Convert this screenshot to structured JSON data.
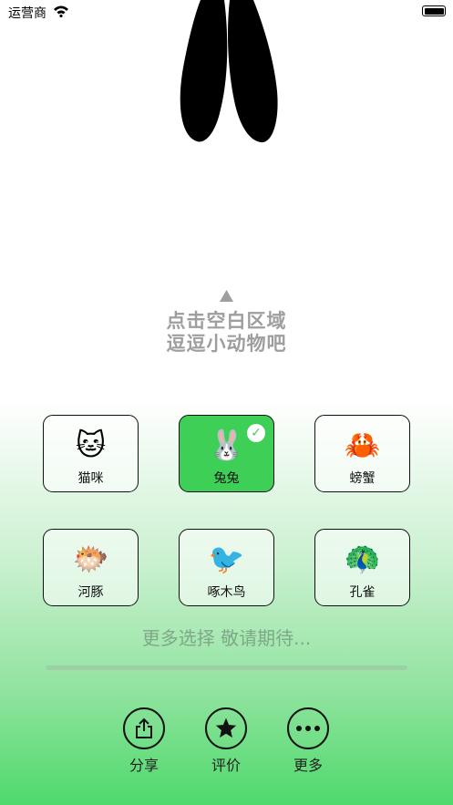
{
  "status_bar": {
    "carrier": "运营商"
  },
  "hint": {
    "line1": "点击空白区域",
    "line2": "逗逗小动物吧"
  },
  "animals": [
    {
      "emoji": "🐱",
      "label": "猫咪",
      "selected": false
    },
    {
      "emoji": "🐰",
      "label": "兔兔",
      "selected": true
    },
    {
      "emoji": "🦀",
      "label": "螃蟹",
      "selected": false
    },
    {
      "emoji": "🐡",
      "label": "河豚",
      "selected": false
    },
    {
      "emoji": "🐦",
      "label": "啄木鸟",
      "selected": false
    },
    {
      "emoji": "🦚",
      "label": "孔雀",
      "selected": false
    }
  ],
  "more_text": "更多选择 敬请期待...",
  "bottom_bar": {
    "share_label": "分享",
    "rate_label": "评价",
    "more_label": "更多"
  },
  "colors": {
    "selected": "#3ecf57",
    "hint": "#9e9e9e"
  }
}
